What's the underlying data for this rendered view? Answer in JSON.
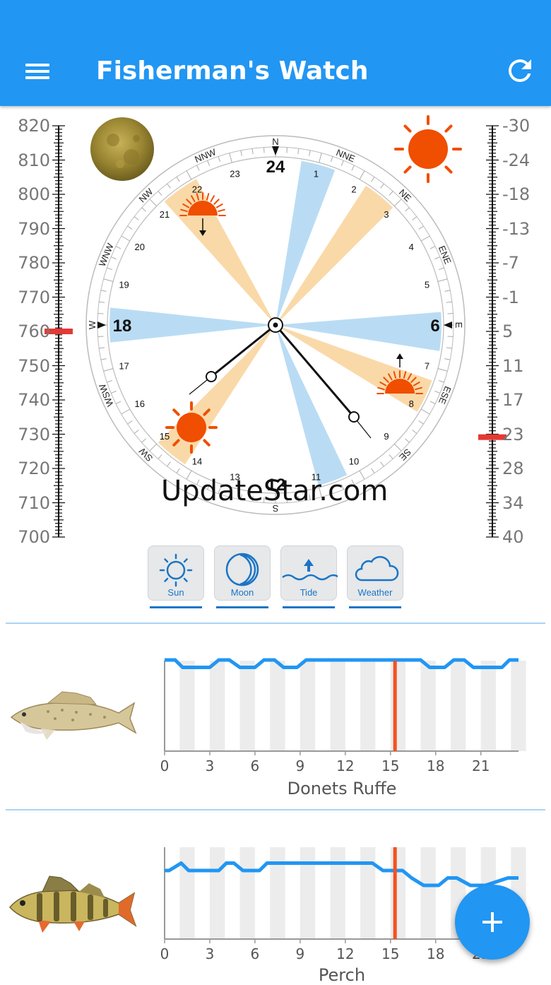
{
  "appbar": {
    "title": "Fisherman's Watch",
    "color": "#2196F3"
  },
  "pressure_gauge": {
    "labels": [
      "820",
      "810",
      "800",
      "790",
      "780",
      "770",
      "760",
      "750",
      "740",
      "730",
      "720",
      "710",
      "700"
    ],
    "current": 760,
    "marker_color": "#e53935"
  },
  "temperature_gauge": {
    "labels": [
      "-30",
      "-24",
      "-18",
      "-13",
      "-7",
      "-1",
      "5",
      "11",
      "17",
      "23",
      "28",
      "34",
      "40"
    ],
    "current": 23,
    "marker_color": "#e53935"
  },
  "dial": {
    "directions": [
      "N",
      "NNE",
      "NE",
      "ENE",
      "E",
      "ESE",
      "SE",
      "S",
      "SW",
      "WSW",
      "W",
      "WNW",
      "NW",
      "NNW"
    ],
    "hours": [
      "1",
      "2",
      "3",
      "4",
      "5",
      "6",
      "7",
      "8",
      "9",
      "10",
      "11",
      "12",
      "13",
      "14",
      "15",
      "16",
      "17",
      "18",
      "19",
      "20",
      "21",
      "22",
      "23",
      "24"
    ],
    "big_hours": {
      "top": "24",
      "right": "6",
      "bottom": "12",
      "left": "18"
    },
    "sun_color": "#f04e00",
    "band_sun_color": "#fad9a8",
    "band_moon_color": "#b9dcf4"
  },
  "tabs": [
    {
      "label": "Sun",
      "icon": "sun-icon"
    },
    {
      "label": "Moon",
      "icon": "moon-icon"
    },
    {
      "label": "Tide",
      "icon": "tide-icon"
    },
    {
      "label": "Weather",
      "icon": "weather-icon"
    }
  ],
  "watermark": "UpdateStar.com",
  "charts": [
    {
      "species": "Donets Ruffe",
      "chart_data": {
        "type": "line",
        "x_ticks": [
          "0",
          "3",
          "6",
          "9",
          "12",
          "15",
          "18",
          "21"
        ],
        "xlim": [
          0,
          23.5
        ],
        "current_time": 15.3,
        "series": [
          {
            "values": [
              [
                0,
                2
              ],
              [
                0.7,
                2
              ],
              [
                1.2,
                1
              ],
              [
                3,
                1
              ],
              [
                3.6,
                2
              ],
              [
                4.3,
                2
              ],
              [
                5,
                1
              ],
              [
                6,
                1
              ],
              [
                6.6,
                2
              ],
              [
                7.3,
                2
              ],
              [
                7.9,
                1
              ],
              [
                8.8,
                1
              ],
              [
                9.4,
                2
              ],
              [
                17,
                2
              ],
              [
                17.6,
                1
              ],
              [
                18.6,
                1
              ],
              [
                19.2,
                2
              ],
              [
                19.9,
                2
              ],
              [
                20.5,
                1
              ],
              [
                22.4,
                1
              ],
              [
                22.9,
                2
              ],
              [
                23.5,
                2
              ]
            ]
          }
        ],
        "line_color": "#2196F3",
        "marker_color": "#f4511e"
      }
    },
    {
      "species": "Perch",
      "chart_data": {
        "type": "line",
        "x_ticks": [
          "0",
          "3",
          "6",
          "9",
          "12",
          "15",
          "18",
          "21"
        ],
        "xlim": [
          0,
          23.5
        ],
        "current_time": 15.3,
        "series": [
          {
            "values": [
              [
                0,
                2
              ],
              [
                0.3,
                2
              ],
              [
                1.1,
                3
              ],
              [
                1.6,
                2
              ],
              [
                3.6,
                2
              ],
              [
                4.1,
                3
              ],
              [
                4.6,
                3
              ],
              [
                5.2,
                2
              ],
              [
                6.3,
                2
              ],
              [
                6.8,
                3
              ],
              [
                13.8,
                3
              ],
              [
                14.5,
                2
              ],
              [
                15.8,
                2
              ],
              [
                16.4,
                1
              ],
              [
                17.2,
                0
              ],
              [
                18.2,
                0
              ],
              [
                18.8,
                1
              ],
              [
                19.4,
                1
              ],
              [
                20.3,
                0
              ],
              [
                21.3,
                0
              ],
              [
                22.8,
                1
              ],
              [
                23.5,
                1
              ]
            ]
          }
        ],
        "line_color": "#2196F3",
        "marker_color": "#f4511e"
      }
    }
  ]
}
